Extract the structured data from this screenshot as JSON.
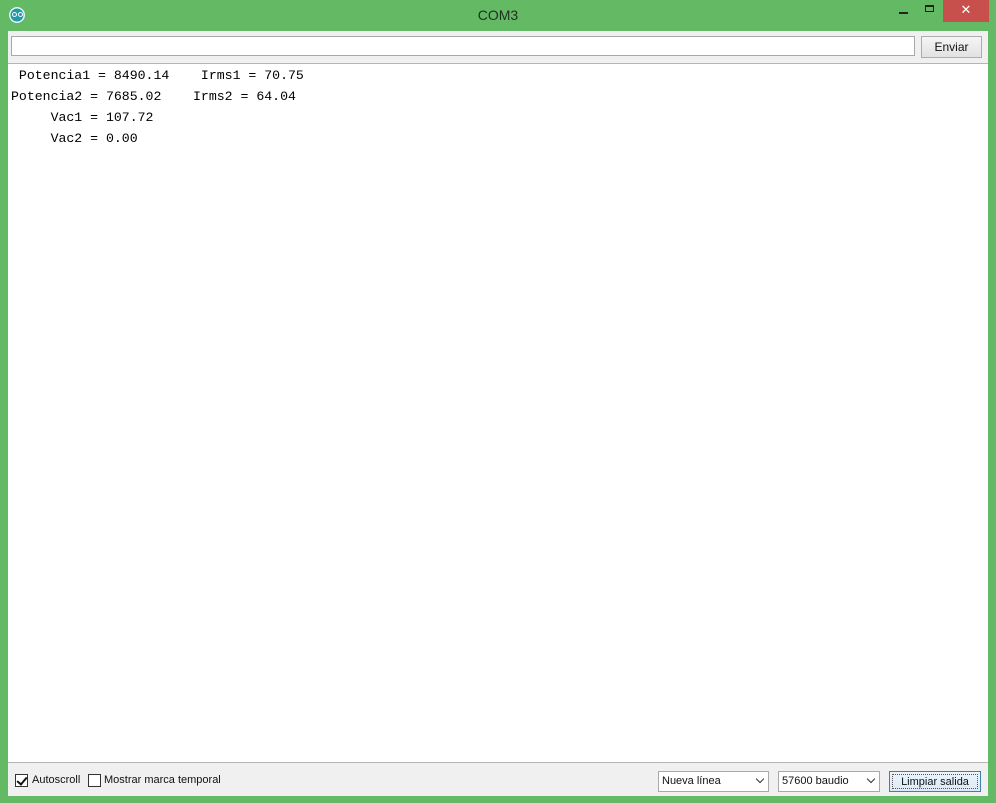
{
  "window": {
    "title": "COM3",
    "close_glyph": "✕"
  },
  "send": {
    "input_value": "",
    "button_label": "Enviar"
  },
  "output": {
    "lines": [
      " Potencia1 = 8490.14    Irms1 = 70.75",
      "Potencia2 = 7685.02    Irms2 = 64.04",
      "     Vac1 = 107.72",
      "     Vac2 = 0.00"
    ]
  },
  "bottombar": {
    "autoscroll_label": "Autoscroll",
    "autoscroll_checked": true,
    "timestamp_label": "Mostrar marca temporal",
    "timestamp_checked": false,
    "line_ending": "Nueva línea",
    "baud_rate": "57600 baudio",
    "clear_label": "Limpiar salida"
  },
  "colors": {
    "window_frame": "#64b964",
    "close_button": "#c7504c",
    "output_background": "#ffffff"
  },
  "icons": {
    "app": "arduino-icon",
    "minimize": "minimize-icon",
    "maximize": "maximize-icon",
    "close": "close-icon",
    "dropdown": "chevron-down-icon",
    "check": "check-icon"
  }
}
